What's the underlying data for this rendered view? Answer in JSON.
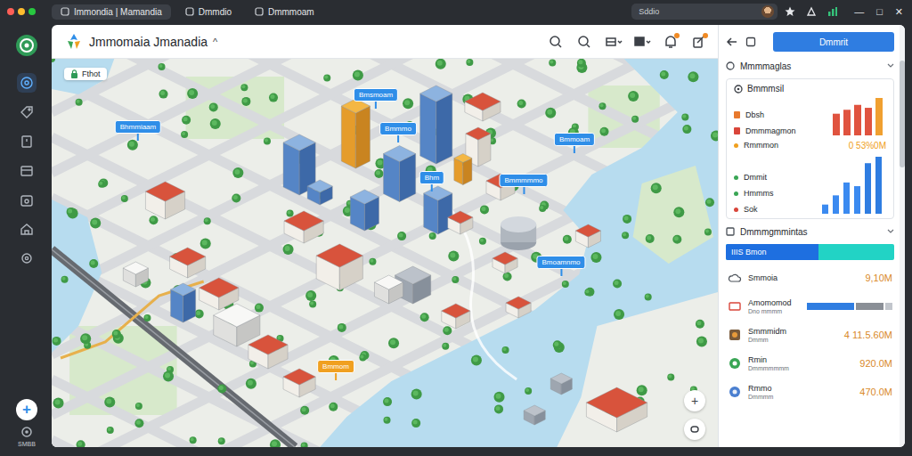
{
  "browser": {
    "tabs": [
      {
        "label": "Immondia | Mamandia",
        "selected": true
      },
      {
        "label": "Dmmdio",
        "selected": false
      },
      {
        "label": "Dmmmoam",
        "selected": false
      }
    ],
    "address": "Sddio",
    "window_controls": [
      "—",
      "□",
      "✕"
    ]
  },
  "sidebar": {
    "items": [
      {
        "selected": true
      },
      {
        "selected": false
      },
      {
        "selected": false
      },
      {
        "selected": false
      },
      {
        "selected": false
      },
      {
        "selected": false
      },
      {
        "selected": false
      }
    ],
    "add": "+",
    "footer": "SMBB"
  },
  "header": {
    "title": "Jmmomaia Jmanadia",
    "chevron": "^",
    "tools": [
      {
        "badge": false
      },
      {
        "badge": false
      },
      {
        "badge": false
      },
      {
        "badge": false
      },
      {
        "badge": true
      },
      {
        "badge": true
      }
    ]
  },
  "map": {
    "status": "Fthot",
    "zoom_in": "+",
    "pins": [
      {
        "label": "Bhmmiaam",
        "color": "#2f8ee8"
      },
      {
        "label": "Bmsmoam",
        "color": "#2f8ee8"
      },
      {
        "label": "Bmmmo",
        "color": "#2f8ee8"
      },
      {
        "label": "Bhm",
        "color": "#2f8ee8"
      },
      {
        "label": "Bmmmmmo",
        "color": "#2f8ee8"
      },
      {
        "label": "Bmmoam",
        "color": "#2f8ee8"
      },
      {
        "label": "Bmoamnmo",
        "color": "#2f8ee8"
      },
      {
        "label": "Bmmom",
        "color": "#f0a020"
      }
    ]
  },
  "panel": {
    "button": "Dmmrit",
    "overview": {
      "title": "Mmmmaglas",
      "expanded": true
    },
    "card": {
      "title": "Bmmmsil",
      "top_items": [
        {
          "label": "Dbsh",
          "color": "#e8792d"
        },
        {
          "label": "Dmmmagmon",
          "color": "#d9453a"
        }
      ],
      "top_chart": {
        "values": [
          22,
          26,
          31,
          28,
          38
        ],
        "colors": [
          "#e0533f",
          "#e0533f",
          "#e0533f",
          "#e0533f",
          "#f0a030"
        ]
      },
      "highlight": {
        "label": "Rmmmon",
        "value": "0 53%0M",
        "color": "#f0a020"
      },
      "items": [
        {
          "label": "Dmmit",
          "color": "#3aa655"
        },
        {
          "label": "Hmmms",
          "color": "#3aa655"
        },
        {
          "label": "Sok",
          "color": "#d9453a"
        }
      ],
      "bottom_chart": {
        "values": [
          10,
          20,
          34,
          30,
          55,
          62
        ]
      }
    },
    "metrics": {
      "title": "Dmmmgmmintas",
      "expanded": true,
      "progress": {
        "label": "IIIS Bmon",
        "level": 0.55
      },
      "rows": [
        {
          "kind": "value",
          "title": "Smmoia",
          "subtitle": "",
          "value": "9,10M"
        },
        {
          "kind": "bar",
          "title": "Amomomod",
          "subtitle": "Dno mmmm",
          "level": 0.55
        },
        {
          "kind": "value",
          "title": "Smmmidm",
          "subtitle": "Dmmm",
          "value": "4 11.5.60M"
        },
        {
          "kind": "value",
          "title": "Rmin",
          "subtitle": "Dmmmmmmm",
          "value": "920.0M"
        },
        {
          "kind": "value",
          "title": "Rmmo",
          "subtitle": "Dmmmm",
          "value": "470.0M"
        }
      ]
    }
  }
}
